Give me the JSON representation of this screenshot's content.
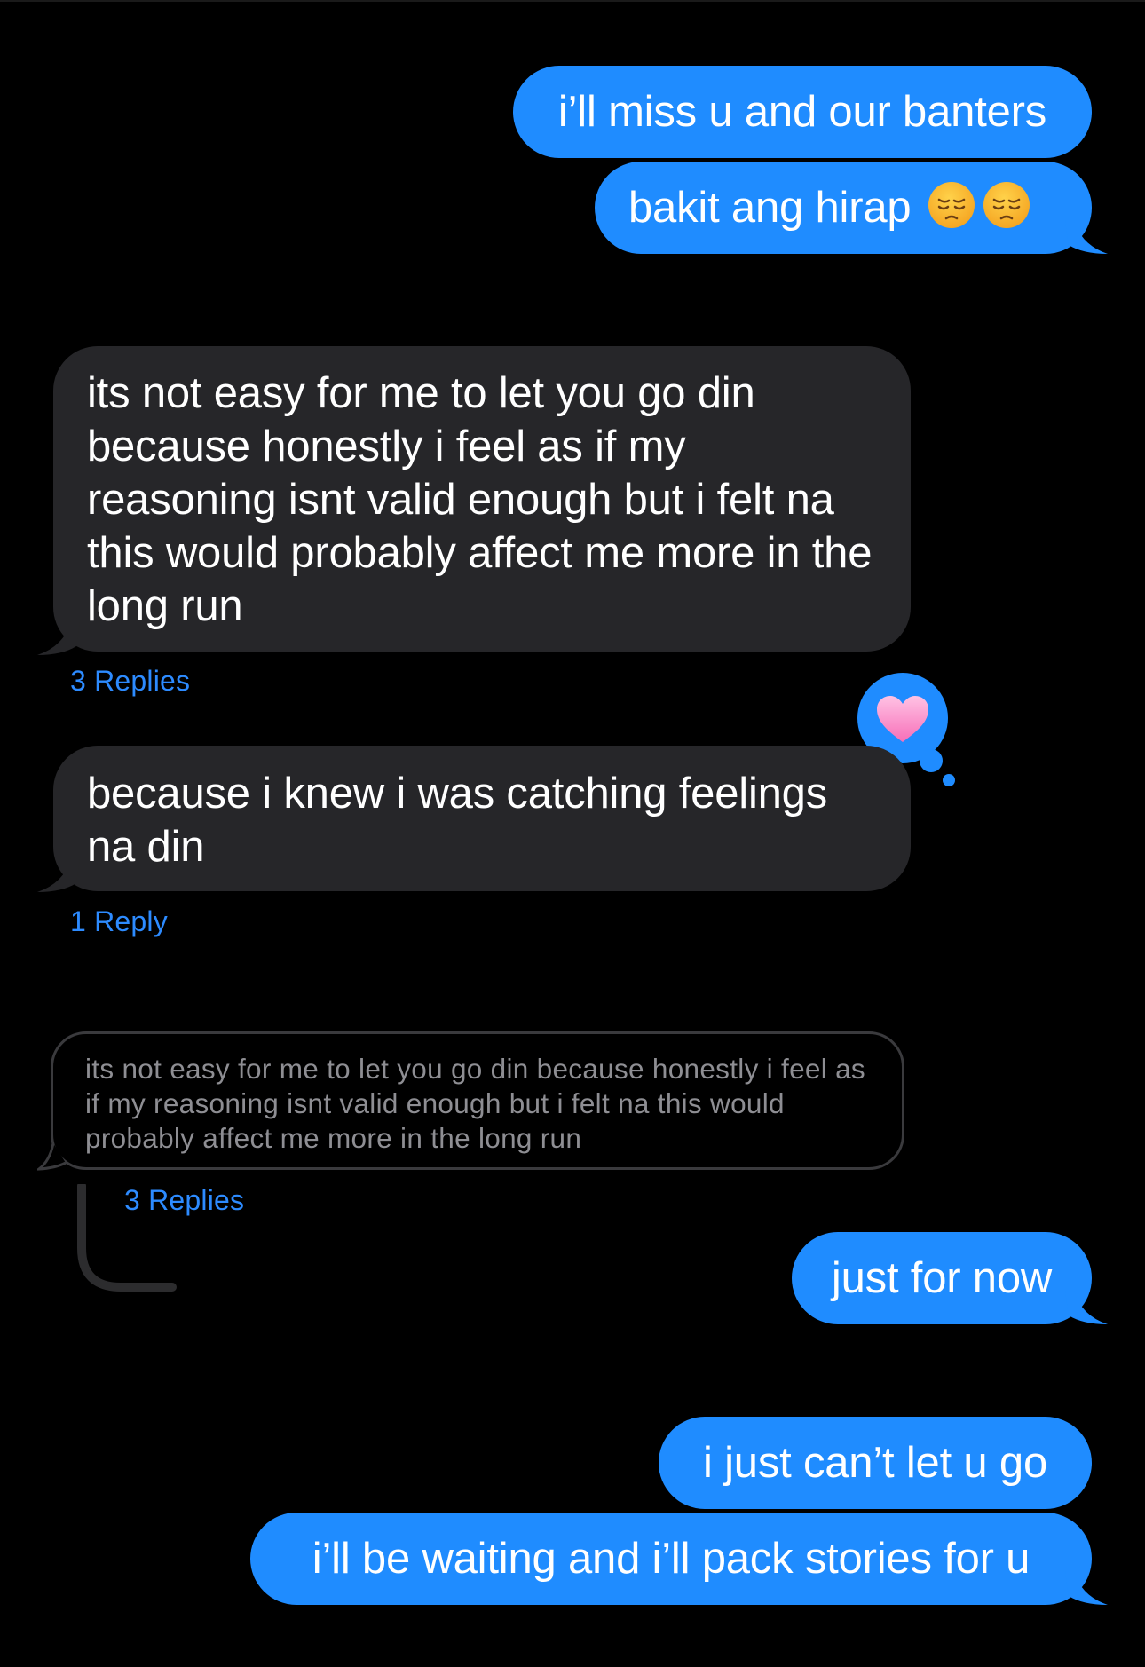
{
  "messages": {
    "sent1": "i’ll miss u and our banters",
    "sent2": "bakit ang hirap",
    "recv1": "its not easy for me to let you go din because honestly i feel as if my reasoning isnt valid enough but i felt na this would probably affect me more in the long run",
    "recv1_replies": "3 Replies",
    "recv2": "because i knew i was catching feelings na din",
    "recv2_replies": "1 Reply",
    "quoted": "its not easy for me to let you go din because honestly i feel as if my reasoning isnt valid enough but i felt na this would probably affect me more in the long run",
    "quoted_replies": "3 Replies",
    "sent3": "just for now",
    "sent4": "i just can’t let u go",
    "sent5": "i’ll be waiting and i’ll pack stories for u"
  },
  "emoji": {
    "sent2_trailing": [
      "pensive-face",
      "pensive-face"
    ],
    "tapback": "pink-heart"
  },
  "colors": {
    "sent_bubble": "#1f8cff",
    "received_bubble": "#262629",
    "reply_link": "#2d8bff",
    "background": "#000000"
  }
}
